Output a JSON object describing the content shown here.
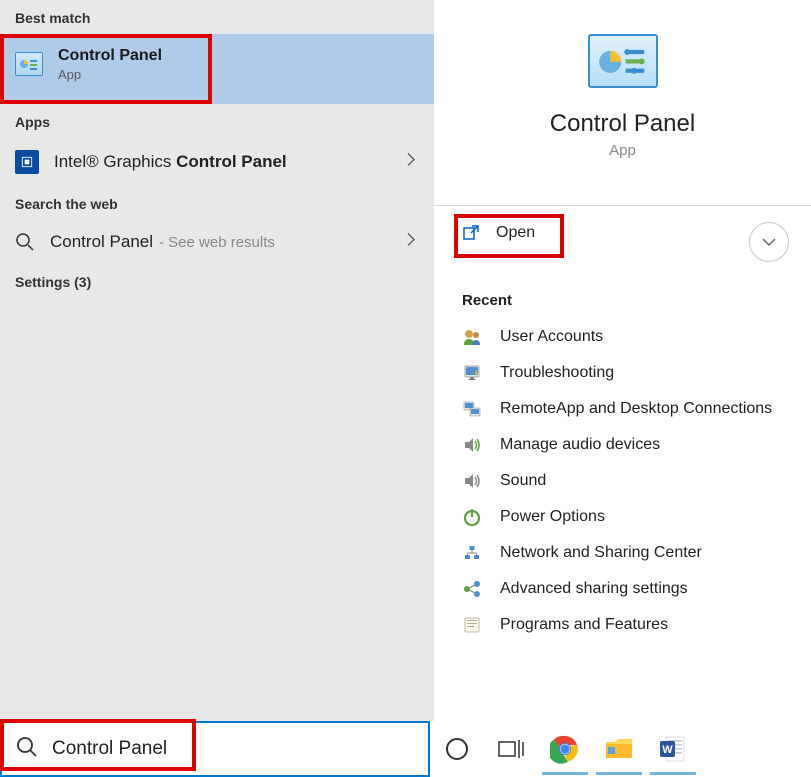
{
  "left": {
    "best_match_header": "Best match",
    "best_match": {
      "title": "Control Panel",
      "subtitle": "App"
    },
    "apps_header": "Apps",
    "apps": [
      {
        "prefix": "Intel® Graphics ",
        "bold": "Control Panel"
      }
    ],
    "web_header": "Search the web",
    "web": [
      {
        "title": "Control Panel",
        "hint": "- See web results"
      }
    ],
    "settings_header": "Settings (3)"
  },
  "right": {
    "hero_title": "Control Panel",
    "hero_subtitle": "App",
    "open_label": "Open",
    "recent_header": "Recent",
    "recents": [
      "User Accounts",
      "Troubleshooting",
      "RemoteApp and Desktop Connections",
      "Manage audio devices",
      "Sound",
      "Power Options",
      "Network and Sharing Center",
      "Advanced sharing settings",
      "Programs and Features"
    ]
  },
  "search": {
    "value": "Control Panel"
  }
}
